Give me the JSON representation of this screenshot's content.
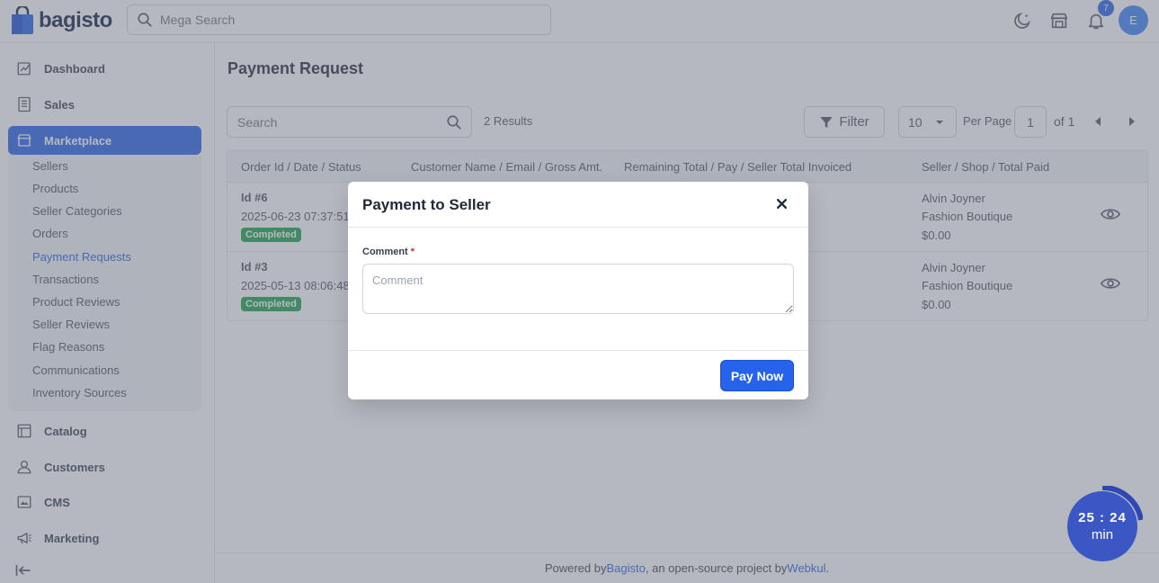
{
  "brand": {
    "name": "bagisto"
  },
  "header": {
    "search_placeholder": "Mega Search",
    "notification_count": "7",
    "avatar_initial": "E"
  },
  "sidebar": {
    "items": [
      {
        "label": "Dashboard",
        "icon": "dashboard-icon"
      },
      {
        "label": "Sales",
        "icon": "sales-icon"
      },
      {
        "label": "Marketplace",
        "icon": "store-icon"
      },
      {
        "label": "Catalog",
        "icon": "catalog-icon"
      },
      {
        "label": "Customers",
        "icon": "user-icon"
      },
      {
        "label": "CMS",
        "icon": "cms-icon"
      },
      {
        "label": "Marketing",
        "icon": "megaphone-icon"
      }
    ],
    "marketplace_sub": [
      "Sellers",
      "Products",
      "Seller Categories",
      "Orders",
      "Payment Requests",
      "Transactions",
      "Product Reviews",
      "Seller Reviews",
      "Flag Reasons",
      "Communications",
      "Inventory Sources"
    ],
    "active_sub": "Payment Requests"
  },
  "page": {
    "title": "Payment Request",
    "search_placeholder": "Search",
    "results": "2 Results",
    "filter_label": "Filter",
    "per_page_value": "10",
    "per_page_label": "Per Page",
    "page_number": "1",
    "page_of": "of 1"
  },
  "table": {
    "headers": [
      "Order Id / Date / Status",
      "Customer Name / Email / Gross Amt.",
      "Remaining Total / Pay / Seller Total Invoiced",
      "Seller / Shop / Total Paid"
    ],
    "rows": [
      {
        "order_id": "Id #6",
        "date": "2025-06-23 07:37:51",
        "status": "Completed",
        "seller": "Alvin Joyner",
        "shop": "Fashion Boutique",
        "total_paid": "$0.00"
      },
      {
        "order_id": "Id #3",
        "date": "2025-05-13 08:06:48",
        "status": "Completed",
        "seller": "Alvin Joyner",
        "shop": "Fashion Boutique",
        "total_paid": "$0.00"
      }
    ]
  },
  "footer": {
    "prefix": "Powered by ",
    "link1": "Bagisto",
    "middle": ", an open-source project by ",
    "link2": "Webkul",
    "suffix": "."
  },
  "modal": {
    "title": "Payment to Seller",
    "comment_label": "Comment",
    "required_mark": "*",
    "comment_placeholder": "Comment",
    "pay_button": "Pay Now"
  },
  "timer": {
    "time": "25 : 24",
    "unit": "min"
  },
  "colors": {
    "primary": "#2563eb",
    "success": "#16a34a",
    "timer": "#3b57c4"
  }
}
